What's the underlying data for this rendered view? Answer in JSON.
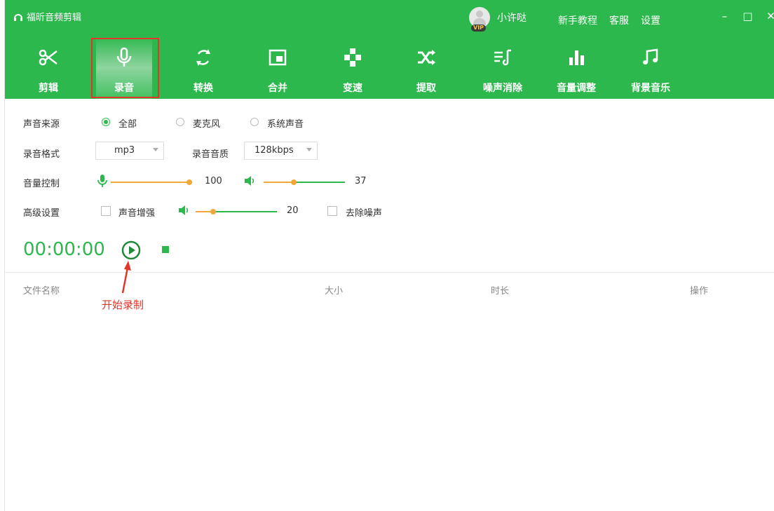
{
  "window": {
    "title": "福昕音频剪辑",
    "user_name": "小许哒",
    "vip_badge": "VIP",
    "top_links": [
      "新手教程",
      "客服",
      "设置"
    ],
    "controls": {
      "minimize": "–",
      "maximize": "□",
      "close": "✕"
    }
  },
  "toolbar": {
    "items": [
      {
        "label": "剪辑",
        "icon": "scissors-icon"
      },
      {
        "label": "录音",
        "icon": "microphone-icon",
        "active": true
      },
      {
        "label": "转换",
        "icon": "convert-icon"
      },
      {
        "label": "合并",
        "icon": "merge-icon"
      },
      {
        "label": "变速",
        "icon": "speed-icon"
      },
      {
        "label": "提取",
        "icon": "extract-icon"
      },
      {
        "label": "噪声消除",
        "icon": "noise-removal-icon"
      },
      {
        "label": "音量调整",
        "icon": "volume-adjust-icon"
      },
      {
        "label": "背景音乐",
        "icon": "music-note-icon"
      }
    ]
  },
  "form": {
    "source": {
      "label": "声音来源",
      "options": [
        "全部",
        "麦克风",
        "系统声音"
      ],
      "selected": "全部"
    },
    "format": {
      "label": "录音格式",
      "value": "mp3"
    },
    "quality": {
      "label": "录音音质",
      "value": "128kbps"
    },
    "volume": {
      "label": "音量控制",
      "mic_value": "100",
      "speaker_value": "37"
    },
    "advanced": {
      "label": "高级设置",
      "enhance_label": "声音增强",
      "enhance_value": "20",
      "denoise_label": "去除噪声"
    }
  },
  "recorder": {
    "time": "00:00:00"
  },
  "file_table": {
    "columns": [
      "文件名称",
      "大小",
      "时长",
      "操作"
    ]
  },
  "annotation": {
    "text": "开始录制"
  },
  "colors": {
    "brand": "#2db84d",
    "slider": "#f0a83a",
    "highlight": "#e3362b"
  }
}
